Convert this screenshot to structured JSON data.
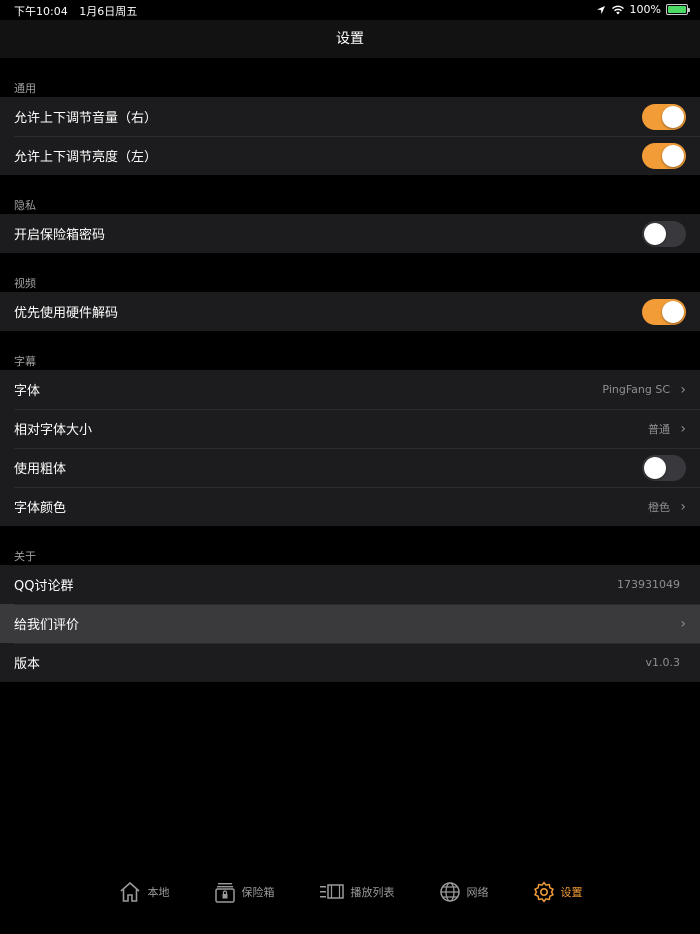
{
  "status_bar": {
    "time": "下午10:04",
    "date": "1月6日周五",
    "battery": "100%"
  },
  "nav": {
    "title": "设置"
  },
  "sections": {
    "general": {
      "header": "通用",
      "volume_label": "允许上下调节音量（右）",
      "brightness_label": "允许上下调节亮度（左）",
      "volume_on": true,
      "brightness_on": true
    },
    "privacy": {
      "header": "隐私",
      "safe_password_label": "开启保险箱密码",
      "safe_password_on": false
    },
    "video": {
      "header": "视频",
      "hw_decode_label": "优先使用硬件解码",
      "hw_decode_on": true
    },
    "subtitle": {
      "header": "字幕",
      "font_label": "字体",
      "font_value": "PingFang SC",
      "size_label": "相对字体大小",
      "size_value": "普通",
      "bold_label": "使用粗体",
      "bold_on": false,
      "color_label": "字体颜色",
      "color_value": "橙色"
    },
    "about": {
      "header": "关于",
      "qq_label": "QQ讨论群",
      "qq_value": "173931049",
      "rate_label": "给我们评价",
      "version_label": "版本",
      "version_value": "v1.0.3"
    }
  },
  "tabs": {
    "local": "本地",
    "safe": "保险箱",
    "playlist": "播放列表",
    "network": "网络",
    "settings": "设置"
  },
  "colors": {
    "accent": "#f19c37",
    "row_bg": "#1c1c1e",
    "highlight_bg": "#3a3a3c"
  },
  "icons": [
    "location-icon",
    "wifi-icon",
    "battery-icon",
    "chevron-right-icon",
    "home-icon",
    "safe-icon",
    "playlist-icon",
    "globe-icon",
    "gear-icon"
  ]
}
